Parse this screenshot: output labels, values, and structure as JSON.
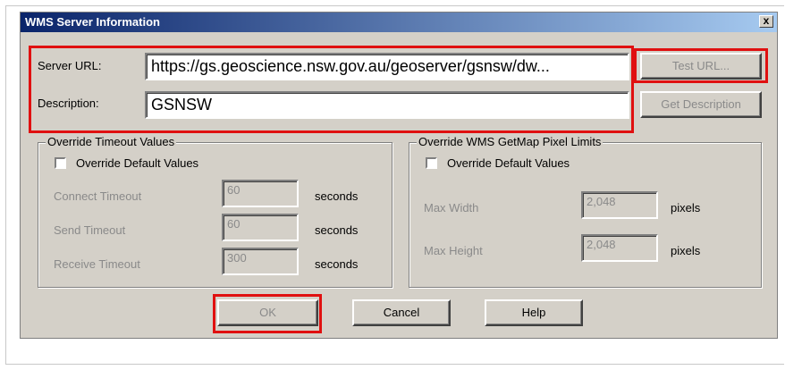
{
  "dialog": {
    "title": "WMS Server Information",
    "close_label": "x"
  },
  "server": {
    "url_label": "Server URL:",
    "url_value": "https://gs.geoscience.nsw.gov.au/geoserver/gsnsw/dw...",
    "description_label": "Description:",
    "description_value": "GSNSW"
  },
  "buttons": {
    "test_url": "Test URL...",
    "get_description": "Get Description",
    "ok": "OK",
    "cancel": "Cancel",
    "help": "Help"
  },
  "timeout_group": {
    "title": "Override Timeout Values",
    "checkbox_label": "Override Default Values",
    "rows": [
      {
        "label": "Connect Timeout",
        "value": "60",
        "unit": "seconds"
      },
      {
        "label": "Send Timeout",
        "value": "60",
        "unit": "seconds"
      },
      {
        "label": "Receive Timeout",
        "value": "300",
        "unit": "seconds"
      }
    ]
  },
  "pixel_group": {
    "title": "Override WMS GetMap Pixel Limits",
    "checkbox_label": "Override Default Values",
    "rows": [
      {
        "label": "Max Width",
        "value": "2,048",
        "unit": "pixels"
      },
      {
        "label": "Max Height",
        "value": "2,048",
        "unit": "pixels"
      }
    ]
  },
  "colors": {
    "highlight": "#e01010",
    "titlebar_start": "#0a246a",
    "titlebar_end": "#a6caf0",
    "dialog_bg": "#d4d0c8"
  }
}
